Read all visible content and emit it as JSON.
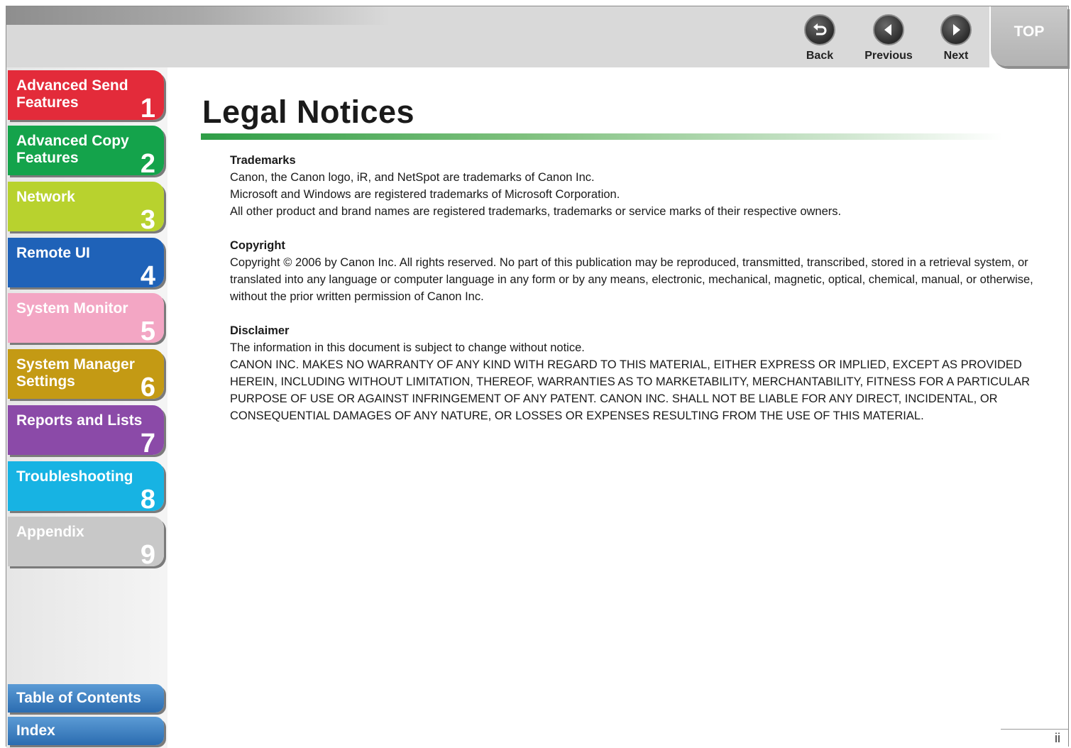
{
  "nav": {
    "back_label": "Back",
    "previous_label": "Previous",
    "next_label": "Next",
    "top_label": "TOP"
  },
  "sidebar": {
    "chapters": [
      {
        "label": "Advanced Send Features",
        "number": "1",
        "color": "#e32b3a"
      },
      {
        "label": "Advanced Copy Features",
        "number": "2",
        "color": "#14a34b"
      },
      {
        "label": "Network",
        "number": "3",
        "color": "#b8d22e"
      },
      {
        "label": "Remote UI",
        "number": "4",
        "color": "#1f62b8"
      },
      {
        "label": "System Monitor",
        "number": "5",
        "color": "#f3a6c4"
      },
      {
        "label": "System Manager Settings",
        "number": "6",
        "color": "#c49a14"
      },
      {
        "label": "Reports and Lists",
        "number": "7",
        "color": "#8b4aa8"
      },
      {
        "label": "Troubleshooting",
        "number": "8",
        "color": "#17b3e3"
      },
      {
        "label": "Appendix",
        "number": "9",
        "color": "#c8c8c8"
      }
    ],
    "toc_label": "Table of Contents",
    "index_label": "Index"
  },
  "page": {
    "title": "Legal Notices",
    "sections": [
      {
        "heading": "Trademarks",
        "lines": [
          "Canon, the Canon logo, iR, and NetSpot are trademarks of Canon Inc.",
          "Microsoft and Windows are registered trademarks of Microsoft Corporation.",
          "All other product and brand names are registered trademarks, trademarks or service marks of their respective owners."
        ]
      },
      {
        "heading": "Copyright",
        "lines": [
          "Copyright © 2006 by Canon Inc. All rights reserved. No part of this publication may be reproduced, transmitted, transcribed, stored in a retrieval system, or translated into any language or computer language in any form or by any means, electronic, mechanical, magnetic, optical, chemical, manual, or otherwise, without the prior written permission of Canon Inc."
        ]
      },
      {
        "heading": "Disclaimer",
        "lines": [
          "The information in this document is subject to change without notice.",
          "CANON INC. MAKES NO WARRANTY OF ANY KIND WITH REGARD TO THIS MATERIAL, EITHER EXPRESS OR IMPLIED, EXCEPT AS PROVIDED HEREIN, INCLUDING WITHOUT LIMITATION, THEREOF, WARRANTIES AS TO MARKETABILITY, MERCHANTABILITY, FITNESS FOR A PARTICULAR PURPOSE OF USE OR AGAINST INFRINGEMENT OF ANY PATENT. CANON INC. SHALL NOT BE LIABLE FOR ANY DIRECT, INCIDENTAL, OR CONSEQUENTIAL DAMAGES OF ANY NATURE, OR LOSSES OR EXPENSES RESULTING FROM THE USE OF THIS MATERIAL."
        ]
      }
    ],
    "page_number": "ii"
  }
}
